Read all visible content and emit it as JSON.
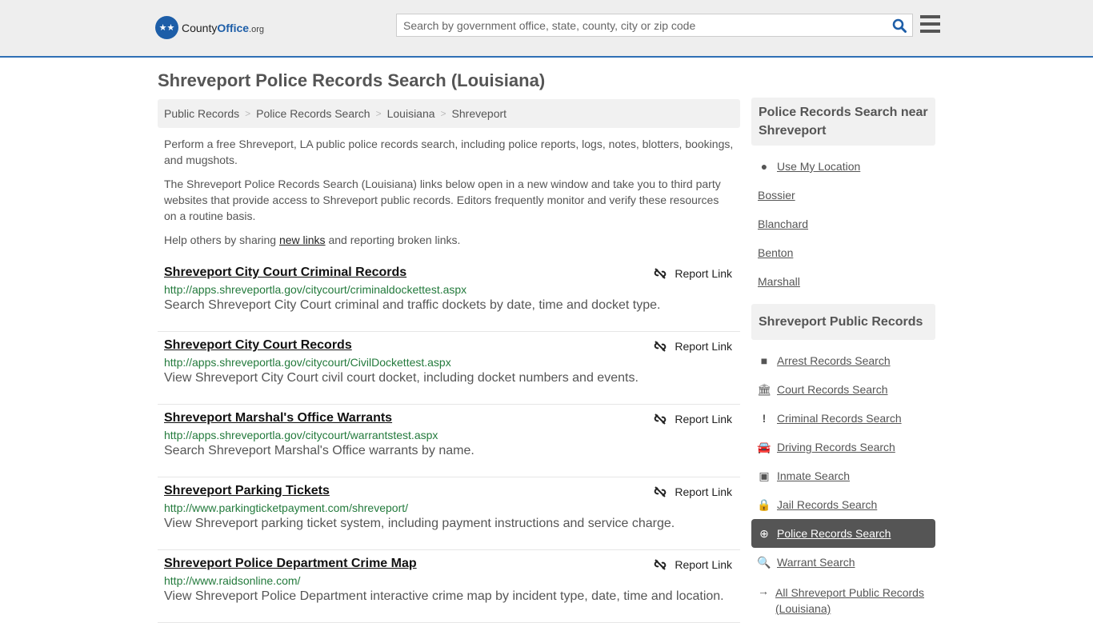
{
  "header": {
    "logo": {
      "county": "County",
      "office": "Office",
      "tld": ".org"
    },
    "search_placeholder": "Search by government office, state, county, city or zip code"
  },
  "page_title": "Shreveport Police Records Search (Louisiana)",
  "breadcrumb": [
    "Public Records",
    "Police Records Search",
    "Louisiana",
    "Shreveport"
  ],
  "intro": {
    "p1": "Perform a free Shreveport, LA public police records search, including police reports, logs, notes, blotters, bookings, and mugshots.",
    "p2": "The Shreveport Police Records Search (Louisiana) links below open in a new window and take you to third party websites that provide access to Shreveport public records. Editors frequently monitor and verify these resources on a routine basis.",
    "p3_before": "Help others by sharing ",
    "p3_link": "new links",
    "p3_after": " and reporting broken links."
  },
  "report_label": "Report Link",
  "entries": [
    {
      "title": "Shreveport City Court Criminal Records",
      "url": "http://apps.shreveportla.gov/citycourt/criminaldockettest.aspx",
      "desc": "Search Shreveport City Court criminal and traffic dockets by date, time and docket type."
    },
    {
      "title": "Shreveport City Court Records",
      "url": "http://apps.shreveportla.gov/citycourt/CivilDockettest.aspx",
      "desc": "View Shreveport City Court civil court docket, including docket numbers and events."
    },
    {
      "title": "Shreveport Marshal's Office Warrants",
      "url": "http://apps.shreveportla.gov/citycourt/warrantstest.aspx",
      "desc": "Search Shreveport Marshal's Office warrants by name."
    },
    {
      "title": "Shreveport Parking Tickets",
      "url": "http://www.parkingticketpayment.com/shreveport/",
      "desc": "View Shreveport parking ticket system, including payment instructions and service charge."
    },
    {
      "title": "Shreveport Police Department Crime Map",
      "url": "http://www.raidsonline.com/",
      "desc": "View Shreveport Police Department interactive crime map by incident type, date, time and location."
    }
  ],
  "sidebar": {
    "near_title": "Police Records Search near Shreveport",
    "near_items": [
      "Use My Location",
      "Bossier",
      "Blanchard",
      "Benton",
      "Marshall"
    ],
    "public_title": "Shreveport Public Records",
    "public_items": [
      "Arrest Records Search",
      "Court Records Search",
      "Criminal Records Search",
      "Driving Records Search",
      "Inmate Search",
      "Jail Records Search",
      "Police Records Search",
      "Warrant Search",
      "All Shreveport Public Records (Louisiana)"
    ],
    "active_item": "Police Records Search"
  }
}
